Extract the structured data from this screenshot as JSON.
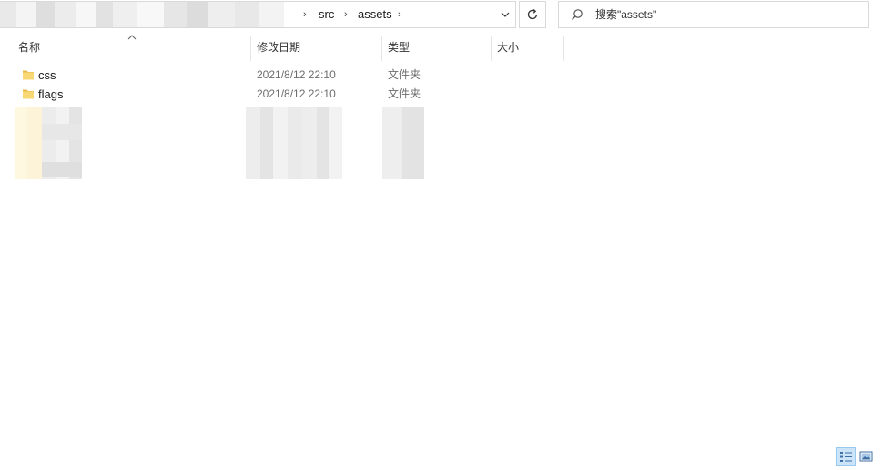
{
  "address": {
    "crumbs": [
      "src",
      "assets"
    ],
    "chevron": "›",
    "dropdown_icon": "chevron-down-icon",
    "refresh_icon": "refresh-icon"
  },
  "search": {
    "placeholder": "搜索\"assets\"",
    "icon": "search-icon"
  },
  "columns": {
    "name": "名称",
    "modified": "修改日期",
    "type": "类型",
    "size": "大小"
  },
  "files": [
    {
      "name": "css",
      "modified": "2021/8/12 22:10",
      "type": "文件夹",
      "icon": "folder-icon"
    },
    {
      "name": "flags",
      "modified": "2021/8/12 22:10",
      "type": "文件夹",
      "icon": "folder-icon"
    }
  ],
  "colors": {
    "folder": "#f8d775",
    "folder_dark": "#e8b84a",
    "selected_view": "#cce4f7",
    "border": "#d9d9d9"
  }
}
